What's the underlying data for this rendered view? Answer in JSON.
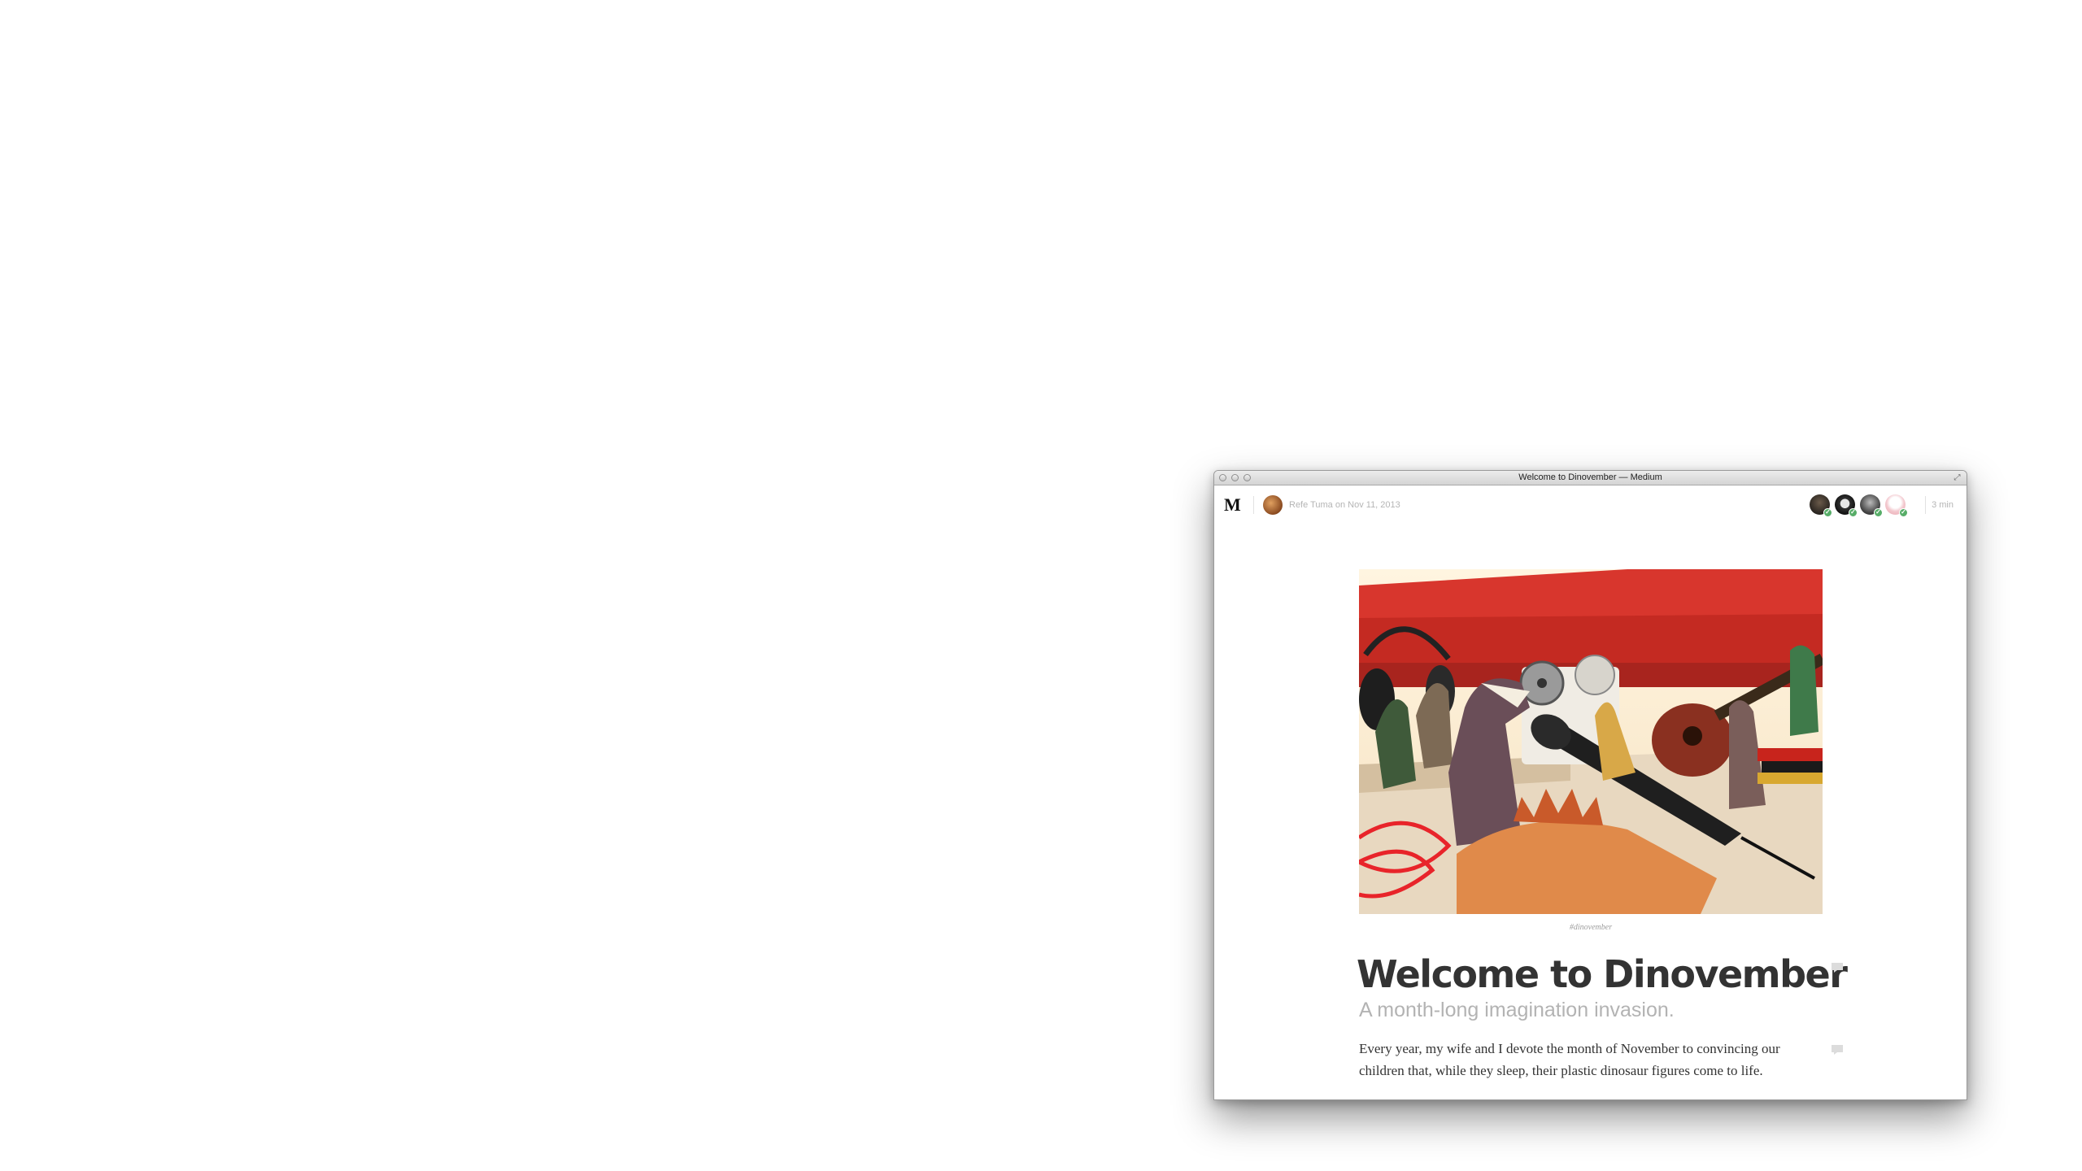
{
  "window": {
    "title": "Welcome to Dinovember — Medium"
  },
  "topbar": {
    "logo": "M",
    "byline": "Refe Tuma on Nov 11, 2013",
    "read_time": "3 min",
    "recommender_count": 4
  },
  "post": {
    "image_caption": "#dinovember",
    "title": "Welcome to Dinovember",
    "subtitle": "A month-long imagination invasion.",
    "paragraph_1": "Every year, my wife and I devote the month of November to convincing our children that, while they sleep, their plastic dinosaur figures come to life.",
    "paragraph_2_fragment": ""
  },
  "colors": {
    "recommend_check": "#57ad68",
    "title_text": "#333333",
    "subtitle_text": "#b3b3b3",
    "meta_text": "#b5b5b5"
  },
  "icons": [
    "medium-logo",
    "note-icon",
    "check-icon",
    "fullscreen-icon"
  ]
}
